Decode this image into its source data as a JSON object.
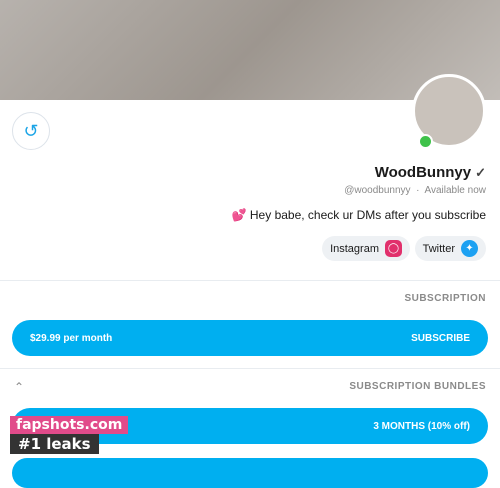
{
  "profile": {
    "cover_alt": "",
    "name": "WoodBunnyy",
    "verified_icon": "verified-icon",
    "handle": "@woodbunnyy",
    "status": "Available now",
    "bio": "Hey babe, check ur DMs after you subscribe",
    "bio_emoji": "💕"
  },
  "socials": [
    {
      "label": "Twitter",
      "icon": "twitter-icon",
      "color": "#1da1f2"
    },
    {
      "label": "Instagram",
      "icon": "instagram-icon",
      "color": "#e1306c"
    }
  ],
  "subscription": {
    "title": "SUBSCRIPTION",
    "button_label": "SUBSCRIBE",
    "price": "$29.99 per month"
  },
  "bundles": {
    "title": "SUBSCRIPTION BUNDLES",
    "items": [
      {
        "label": "3 MONTHS (10% off)"
      }
    ]
  },
  "watermark": {
    "line1": "fapshots.com",
    "line2": "#1 leaks"
  },
  "colors": {
    "accent": "#00aff0",
    "online": "#3fc24a"
  }
}
